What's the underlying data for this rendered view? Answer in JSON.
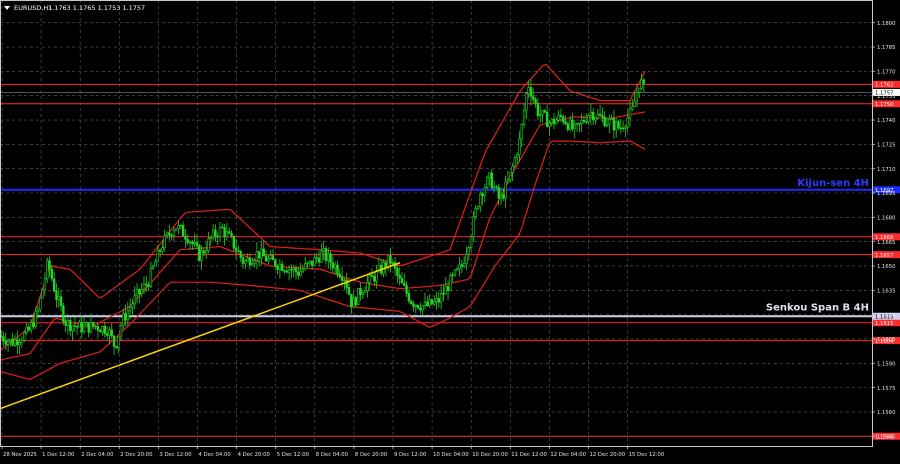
{
  "header": {
    "symbol": "EURUSD,H1",
    "ohlc": "1.1763 1.1765 1.1753 1.1757"
  },
  "chart_data": {
    "type": "candlestick",
    "ylim": [
      1.1539,
      1.1814
    ],
    "price_ticks": [
      "1.1800",
      "1.1785",
      "1.1770",
      "1.1755",
      "1.1740",
      "1.1725",
      "1.1710",
      "1.1695",
      "1.1680",
      "1.1665",
      "1.1650",
      "1.1635",
      "1.1620",
      "1.1605",
      "1.1590",
      "1.1575",
      "1.1560",
      "1.1545"
    ],
    "time_ticks": [
      "28 Nov 2025",
      "1 Dec 12:00",
      "2 Dec 04:00",
      "2 Dec 20:00",
      "3 Dec 12:00",
      "4 Dec 04:00",
      "4 Dec 20:00",
      "5 Dec 12:00",
      "8 Dec 04:00",
      "8 Dec 20:00",
      "9 Dec 12:00",
      "10 Dec 04:00",
      "10 Dec 20:00",
      "11 Dec 12:00",
      "12 Dec 04:00",
      "12 Dec 20:00",
      "15 Dec 12:00"
    ],
    "levels": [
      {
        "price": 1.1762,
        "label": "1.1762",
        "color": "#ff2a2a"
      },
      {
        "price": 1.175,
        "label": "1.1750",
        "color": "#ff2a2a"
      },
      {
        "price": 1.1668,
        "label": "1.1668",
        "color": "#ff2a2a"
      },
      {
        "price": 1.1657,
        "label": "1.1657",
        "color": "#ff2a2a"
      },
      {
        "price": 1.1615,
        "label": "1.1615",
        "color": "#ff2a2a"
      },
      {
        "price": 1.1604,
        "label": "1.1604",
        "color": "#ff2a2a"
      },
      {
        "price": 1.1545,
        "label": "1.1545",
        "color": "#ff2a2a"
      }
    ],
    "kijun_line": {
      "price": 1.1697,
      "label": "1.1697",
      "name": "Kijun-sen 4H",
      "color": "#1a2dff"
    },
    "senkou_line": {
      "price": 1.1619,
      "label": "1.1619",
      "name": "Senkou Span B 4H",
      "color": "#d0d0ee"
    },
    "current_price": {
      "price": 1.1757,
      "label": "1.1757"
    },
    "trend_line": {
      "from": [
        0,
        1.1562
      ],
      "to": [
        400,
        1.1652
      ],
      "color": "#ffd400"
    },
    "candles_count": 280,
    "path_knots": [
      [
        0,
        1.1607
      ],
      [
        12,
        1.1603
      ],
      [
        28,
        1.1609
      ],
      [
        38,
        1.1622
      ],
      [
        48,
        1.1652
      ],
      [
        56,
        1.1632
      ],
      [
        66,
        1.1615
      ],
      [
        80,
        1.1612
      ],
      [
        95,
        1.1613
      ],
      [
        108,
        1.1611
      ],
      [
        115,
        1.16
      ],
      [
        122,
        1.1616
      ],
      [
        135,
        1.163
      ],
      [
        148,
        1.164
      ],
      [
        162,
        1.1663
      ],
      [
        175,
        1.1675
      ],
      [
        188,
        1.1668
      ],
      [
        200,
        1.1656
      ],
      [
        212,
        1.1668
      ],
      [
        222,
        1.1673
      ],
      [
        232,
        1.1665
      ],
      [
        244,
        1.1652
      ],
      [
        258,
        1.1658
      ],
      [
        270,
        1.1653
      ],
      [
        284,
        1.165
      ],
      [
        298,
        1.1646
      ],
      [
        312,
        1.1652
      ],
      [
        322,
        1.1658
      ],
      [
        335,
        1.165
      ],
      [
        345,
        1.1643
      ],
      [
        352,
        1.1626
      ],
      [
        362,
        1.1636
      ],
      [
        375,
        1.1644
      ],
      [
        390,
        1.1654
      ],
      [
        400,
        1.164
      ],
      [
        412,
        1.1628
      ],
      [
        425,
        1.1625
      ],
      [
        438,
        1.1628
      ],
      [
        450,
        1.164
      ],
      [
        462,
        1.165
      ],
      [
        470,
        1.1668
      ],
      [
        480,
        1.1695
      ],
      [
        490,
        1.1704
      ],
      [
        500,
        1.169
      ],
      [
        510,
        1.1705
      ],
      [
        520,
        1.1728
      ],
      [
        528,
        1.1763
      ],
      [
        538,
        1.1745
      ],
      [
        550,
        1.1738
      ],
      [
        562,
        1.1742
      ],
      [
        575,
        1.1733
      ],
      [
        590,
        1.1745
      ],
      [
        605,
        1.174
      ],
      [
        620,
        1.1735
      ],
      [
        632,
        1.1745
      ],
      [
        640,
        1.1765
      ],
      [
        645,
        1.1757
      ]
    ],
    "ichimoku_upper": [
      [
        0,
        1.1598
      ],
      [
        30,
        1.1612
      ],
      [
        50,
        1.165
      ],
      [
        70,
        1.1648
      ],
      [
        100,
        1.163
      ],
      [
        140,
        1.1648
      ],
      [
        185,
        1.1683
      ],
      [
        230,
        1.1685
      ],
      [
        270,
        1.1662
      ],
      [
        320,
        1.166
      ],
      [
        360,
        1.1658
      ],
      [
        400,
        1.165
      ],
      [
        450,
        1.166
      ],
      [
        485,
        1.172
      ],
      [
        520,
        1.1758
      ],
      [
        545,
        1.1775
      ],
      [
        570,
        1.1758
      ],
      [
        600,
        1.1752
      ],
      [
        630,
        1.1752
      ],
      [
        645,
        1.177
      ]
    ],
    "ichimoku_lower": [
      [
        0,
        1.1585
      ],
      [
        30,
        1.158
      ],
      [
        60,
        1.159
      ],
      [
        100,
        1.1597
      ],
      [
        130,
        1.1614
      ],
      [
        170,
        1.164
      ],
      [
        210,
        1.164
      ],
      [
        250,
        1.1638
      ],
      [
        300,
        1.1635
      ],
      [
        350,
        1.1625
      ],
      [
        400,
        1.1622
      ],
      [
        430,
        1.1612
      ],
      [
        450,
        1.1618
      ],
      [
        470,
        1.1625
      ],
      [
        495,
        1.165
      ],
      [
        520,
        1.167
      ],
      [
        535,
        1.17
      ],
      [
        550,
        1.1727
      ],
      [
        570,
        1.1727
      ],
      [
        600,
        1.1726
      ],
      [
        630,
        1.1727
      ],
      [
        645,
        1.1722
      ]
    ],
    "ichimoku_mid": [
      [
        0,
        1.1592
      ],
      [
        30,
        1.1596
      ],
      [
        55,
        1.1618
      ],
      [
        90,
        1.1612
      ],
      [
        130,
        1.1625
      ],
      [
        180,
        1.166
      ],
      [
        220,
        1.1662
      ],
      [
        270,
        1.165
      ],
      [
        320,
        1.1648
      ],
      [
        360,
        1.164
      ],
      [
        400,
        1.1636
      ],
      [
        440,
        1.1638
      ],
      [
        470,
        1.1642
      ],
      [
        490,
        1.168
      ],
      [
        515,
        1.171
      ],
      [
        540,
        1.1737
      ],
      [
        575,
        1.1742
      ],
      [
        610,
        1.1741
      ],
      [
        645,
        1.1745
      ]
    ]
  }
}
